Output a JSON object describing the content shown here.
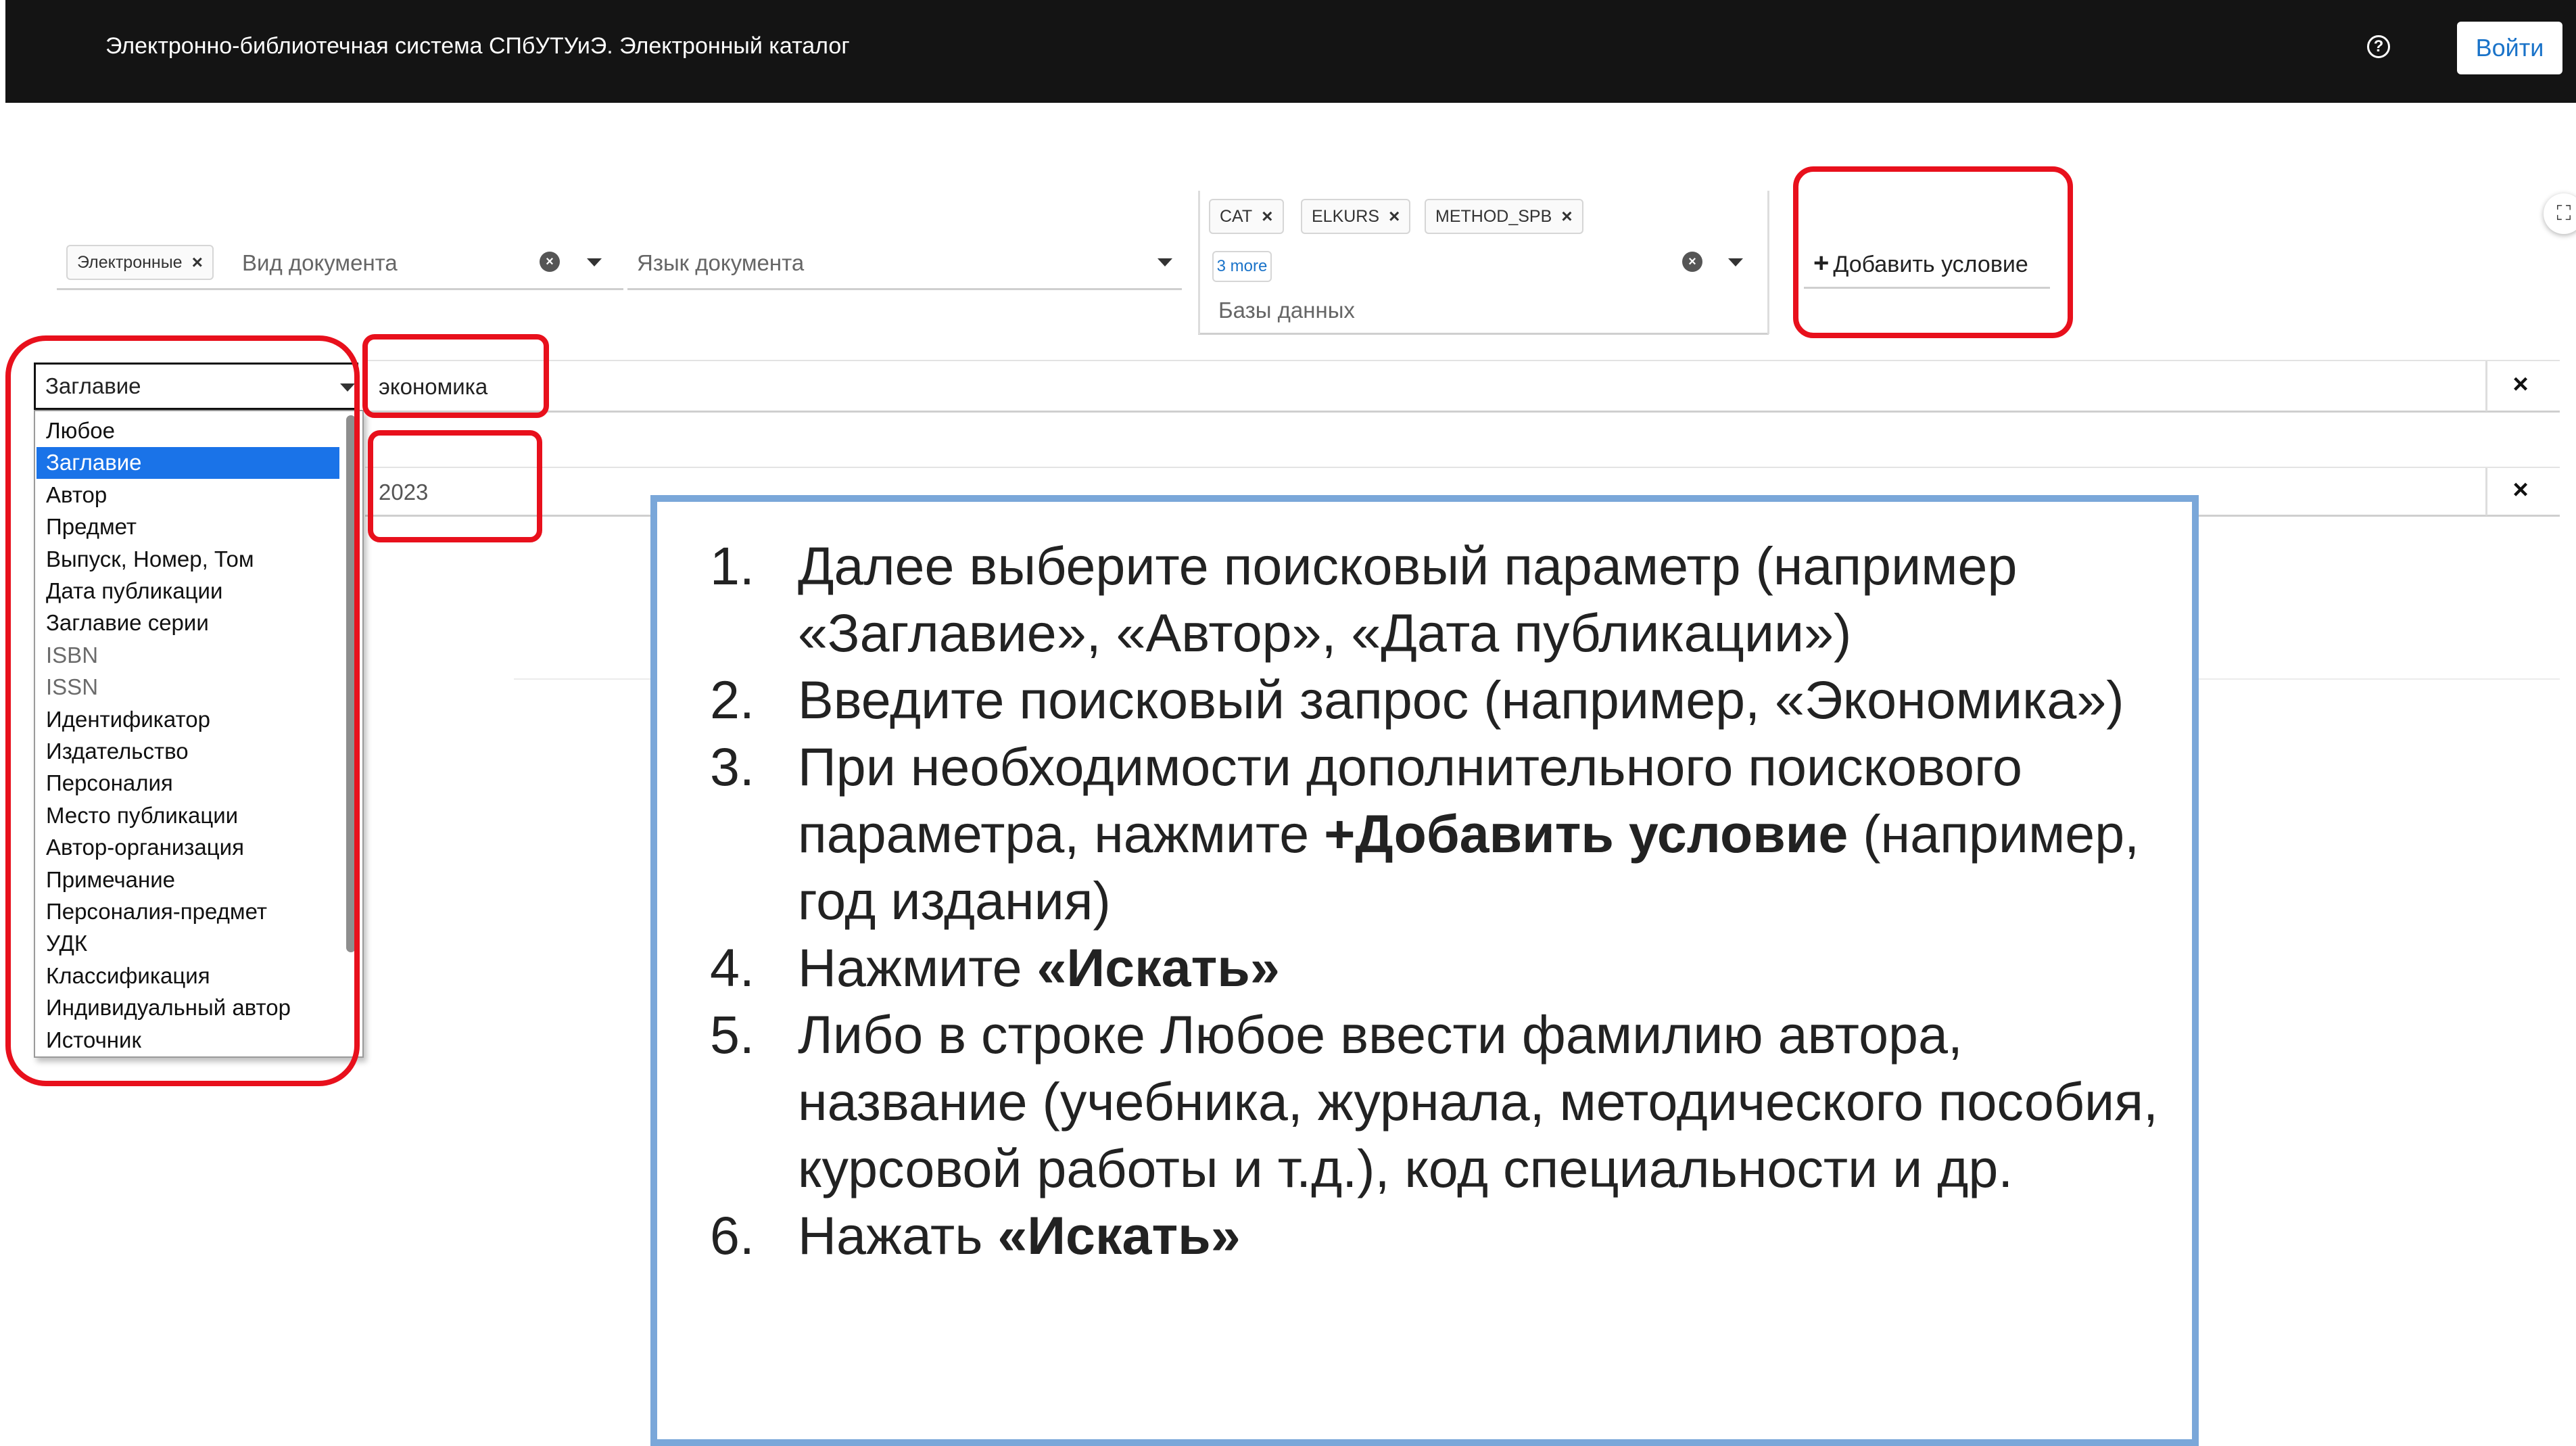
{
  "header": {
    "title": "Электронно-библиотечная система СПбУТУиЭ. Электронный каталог",
    "help_icon": "?",
    "login_label": "Войти"
  },
  "filters": {
    "access_chip": "Электронные",
    "doc_type_placeholder": "Вид документа",
    "language_placeholder": "Язык документа",
    "db_chips": [
      "CAT",
      "ELKURS",
      "METHOD_SPB"
    ],
    "db_more": "3 more",
    "db_label": "Базы данных",
    "add_condition_label": "Добавить условие"
  },
  "search_rows": [
    {
      "field": "Заглавие",
      "value": "экономика"
    },
    {
      "value": "2023"
    }
  ],
  "field_options": [
    {
      "label": "Любое",
      "state": "normal"
    },
    {
      "label": "Заглавие",
      "state": "selected"
    },
    {
      "label": "Автор",
      "state": "normal"
    },
    {
      "label": "Предмет",
      "state": "normal"
    },
    {
      "label": "Выпуск, Номер, Том",
      "state": "normal"
    },
    {
      "label": "Дата публикации",
      "state": "normal"
    },
    {
      "label": "Заглавие серии",
      "state": "normal"
    },
    {
      "label": "ISBN",
      "state": "disabled"
    },
    {
      "label": "ISSN",
      "state": "disabled"
    },
    {
      "label": "Идентификатор",
      "state": "normal"
    },
    {
      "label": "Издательство",
      "state": "normal"
    },
    {
      "label": "Персоналия",
      "state": "normal"
    },
    {
      "label": "Место публикации",
      "state": "normal"
    },
    {
      "label": "Автор-организация",
      "state": "normal"
    },
    {
      "label": "Примечание",
      "state": "normal"
    },
    {
      "label": "Персоналия-предмет",
      "state": "normal"
    },
    {
      "label": "УДК",
      "state": "normal"
    },
    {
      "label": "Классификация",
      "state": "normal"
    },
    {
      "label": "Индивидуальный автор",
      "state": "normal"
    },
    {
      "label": "Источник",
      "state": "normal"
    }
  ],
  "instructions": [
    {
      "num": "1.",
      "parts": [
        {
          "t": "Далее выберите поисковый параметр (например «Заглавие», «Автор», «Дата публикации»)"
        }
      ]
    },
    {
      "num": "2.",
      "parts": [
        {
          "t": "Введите поисковый запрос (например, «Экономика»)"
        }
      ]
    },
    {
      "num": "3.",
      "parts": [
        {
          "t": "При необходимости дополнительного поискового параметра, нажмите "
        },
        {
          "t": "+Добавить условие",
          "b": true
        },
        {
          "t": " (например, год издания)"
        }
      ]
    },
    {
      "num": "4.",
      "parts": [
        {
          "t": "Нажмите "
        },
        {
          "t": "«Искать»",
          "b": true
        }
      ]
    },
    {
      "num": "5.",
      "parts": [
        {
          "t": "Либо в строке Любое ввести фамилию автора, название (учебника, журнала, методического пособия, курсовой работы и т.д.), код специальности и др."
        }
      ]
    },
    {
      "num": "6.",
      "parts": [
        {
          "t": "Нажать "
        },
        {
          "t": "«Искать»",
          "b": true
        }
      ]
    }
  ],
  "colors": {
    "header_bg": "#141414",
    "highlight": "#e8101c",
    "instructions_border": "#7aa7d9",
    "selected_option": "#1a73e8",
    "login_text": "#1a73c9"
  }
}
